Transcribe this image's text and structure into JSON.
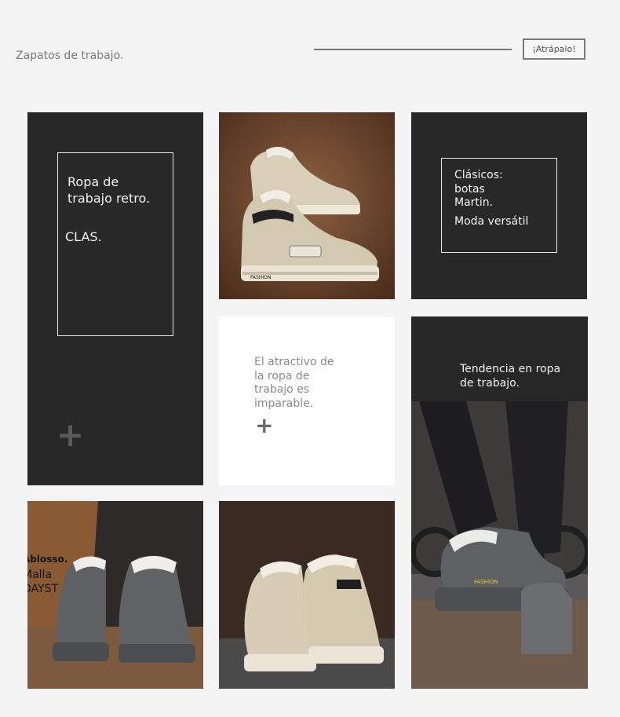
{
  "header": {
    "subtitle": "Zapatos de trabajo.",
    "cta_label": "¡Atrápalo!"
  },
  "tiles": {
    "retro": {
      "line1": "Ropa de",
      "line2": "trabajo retro.",
      "tag": "CLAS.",
      "plus": "+"
    },
    "classic": {
      "line1": "Clásicos:",
      "line2": "botas",
      "line3": "Martin.",
      "line4": "Moda versátil"
    },
    "appeal": {
      "line1": "El atractivo de",
      "line2": "la ropa de",
      "line3": "trabajo es",
      "line4": "imparable.",
      "plus": "+"
    },
    "trend": {
      "line1": "Tendencia en ropa",
      "line2": "de trabajo."
    },
    "grey_photo": {
      "brand": "Ablosso.",
      "line1": "Malla",
      "line2": "DAYST"
    },
    "sole_text": "FASHION"
  },
  "colors": {
    "dark_tile": "#282828",
    "page_bg": "#f4f4f4",
    "beige_shoe": "#d9cfb8",
    "grey_shoe": "#5e6064"
  }
}
